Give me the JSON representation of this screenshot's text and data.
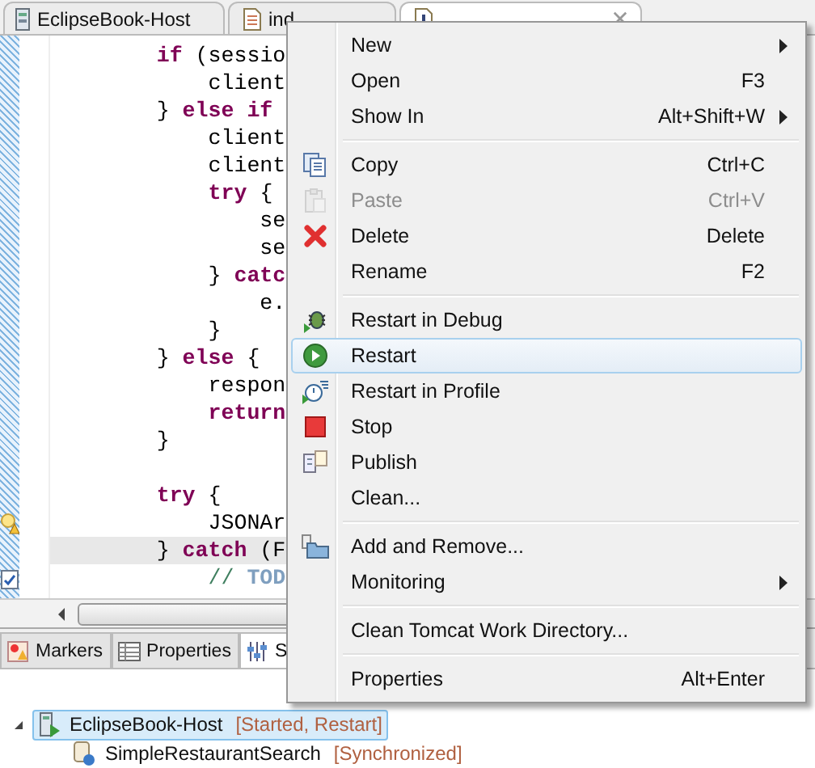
{
  "editor_tabs": [
    {
      "label": "EclipseBook-Host",
      "selected": false,
      "closable": false
    },
    {
      "label": "ind",
      "selected": false,
      "closable": false
    },
    {
      "selected": true,
      "closable": true
    }
  ],
  "code_lines": [
    {
      "kind": "code",
      "current": false,
      "text": "        **if** (sessio"
    },
    {
      "kind": "code",
      "current": false,
      "text": "            client"
    },
    {
      "kind": "code",
      "current": false,
      "text": "        } **else if**"
    },
    {
      "kind": "code",
      "current": false,
      "text": "            client"
    },
    {
      "kind": "code",
      "current": false,
      "text": "            client"
    },
    {
      "kind": "code",
      "current": false,
      "text": "            **try** {"
    },
    {
      "kind": "code",
      "current": false,
      "text": "                se"
    },
    {
      "kind": "code",
      "current": false,
      "text": "                se"
    },
    {
      "kind": "code",
      "current": false,
      "text": "            } **catc**"
    },
    {
      "kind": "code",
      "current": false,
      "text": "                e."
    },
    {
      "kind": "code",
      "current": false,
      "text": "            }"
    },
    {
      "kind": "code",
      "current": false,
      "text": "        } **else** {"
    },
    {
      "kind": "code",
      "current": false,
      "text": "            respon"
    },
    {
      "kind": "code",
      "current": false,
      "text": "            **return**"
    },
    {
      "kind": "code",
      "current": false,
      "text": "        }"
    },
    {
      "kind": "blank",
      "current": false
    },
    {
      "kind": "code",
      "current": false,
      "text": "        **try** {"
    },
    {
      "kind": "warning",
      "current": false,
      "text": "            JSONAr"
    },
    {
      "kind": "code",
      "current": true,
      "text": "        } **catch** (F"
    },
    {
      "kind": "task",
      "current": false,
      "text": "            // **TOD**"
    }
  ],
  "bottom_tabs": [
    {
      "label": "Markers",
      "selected": false
    },
    {
      "label": "Properties",
      "selected": false
    },
    {
      "label": "S",
      "selected": true
    }
  ],
  "servers": [
    {
      "name": "EclipseBook-Host",
      "status": "[Started, Restart]",
      "selected": true,
      "expanded": true,
      "children": [
        {
          "name": "SimpleRestaurantSearch",
          "status": "[Synchronized]",
          "selected": false
        }
      ]
    }
  ],
  "context_menu": [
    {
      "kind": "item",
      "label": "New",
      "submenu": true,
      "disabled": false,
      "selected": false
    },
    {
      "kind": "item",
      "label": "Open",
      "shortcut": "F3",
      "submenu": false,
      "disabled": false,
      "selected": false
    },
    {
      "kind": "item",
      "label": "Show In",
      "shortcut": "Alt+Shift+W",
      "submenu": true,
      "disabled": false,
      "selected": false
    },
    {
      "kind": "separator"
    },
    {
      "kind": "item",
      "label": "Copy",
      "shortcut": "Ctrl+C",
      "submenu": false,
      "disabled": false,
      "selected": false
    },
    {
      "kind": "item",
      "label": "Paste",
      "shortcut": "Ctrl+V",
      "submenu": false,
      "disabled": true,
      "selected": false
    },
    {
      "kind": "item",
      "label": "Delete",
      "shortcut": "Delete",
      "submenu": false,
      "disabled": false,
      "selected": false
    },
    {
      "kind": "item",
      "label": "Rename",
      "shortcut": "F2",
      "submenu": false,
      "disabled": false,
      "selected": false
    },
    {
      "kind": "separator"
    },
    {
      "kind": "item",
      "label": "Restart in Debug",
      "submenu": false,
      "disabled": false,
      "selected": false
    },
    {
      "kind": "item",
      "label": "Restart",
      "submenu": false,
      "disabled": false,
      "selected": true
    },
    {
      "kind": "item",
      "label": "Restart in Profile",
      "submenu": false,
      "disabled": false,
      "selected": false
    },
    {
      "kind": "item",
      "label": "Stop",
      "submenu": false,
      "disabled": false,
      "selected": false
    },
    {
      "kind": "item",
      "label": "Publish",
      "submenu": false,
      "disabled": false,
      "selected": false
    },
    {
      "kind": "item",
      "label": "Clean...",
      "submenu": false,
      "disabled": false,
      "selected": false
    },
    {
      "kind": "separator"
    },
    {
      "kind": "item",
      "label": "Add and Remove...",
      "submenu": false,
      "disabled": false,
      "selected": false
    },
    {
      "kind": "item",
      "label": "Monitoring",
      "submenu": true,
      "disabled": false,
      "selected": false
    },
    {
      "kind": "separator"
    },
    {
      "kind": "item",
      "label": "Clean Tomcat Work Directory...",
      "submenu": false,
      "disabled": false,
      "selected": false
    },
    {
      "kind": "separator"
    },
    {
      "kind": "item",
      "label": "Properties",
      "shortcut": "Alt+Enter",
      "submenu": false,
      "disabled": false,
      "selected": false
    }
  ]
}
